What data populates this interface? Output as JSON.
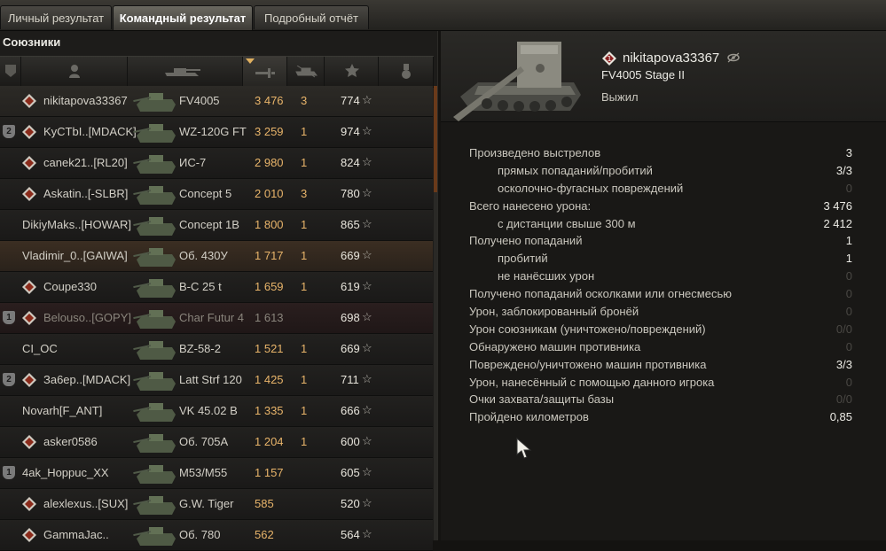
{
  "tabs": [
    {
      "label": "Личный результат"
    },
    {
      "label": "Командный результат"
    },
    {
      "label": "Подробный отчёт"
    }
  ],
  "allies_title": "Союзники",
  "allies": [
    {
      "player": "nikitapova33367",
      "tank": "FV4005",
      "damage": "3 476",
      "kills": "3",
      "xp": "774",
      "platoon": "",
      "rank": "rank-icon"
    },
    {
      "player": "KyCTbI..[MDACK]",
      "tank": "WZ-120G FT",
      "damage": "3 259",
      "kills": "1",
      "xp": "974",
      "platoon": "2",
      "rank": "clan-emblem-icon"
    },
    {
      "player": "canek21..[RL20]",
      "tank": "ИС-7",
      "damage": "2 980",
      "kills": "1",
      "xp": "824",
      "platoon": "",
      "rank": "rank-icon"
    },
    {
      "player": "Askatin..[-SLBR]",
      "tank": "Concept 5",
      "damage": "2 010",
      "kills": "3",
      "xp": "780",
      "platoon": "",
      "rank": "rank-icon"
    },
    {
      "player": "DikiyMaks..[HOWAR]",
      "tank": "Concept 1B",
      "damage": "1 800",
      "kills": "1",
      "xp": "865",
      "platoon": "",
      "rank": ""
    },
    {
      "player": "Vladimir_0..[GAIWA]",
      "tank": "Об. 430У",
      "damage": "1 717",
      "kills": "1",
      "xp": "669",
      "platoon": "",
      "rank": ""
    },
    {
      "player": "Coupe330",
      "tank": "B-C 25 t",
      "damage": "1 659",
      "kills": "1",
      "xp": "619",
      "platoon": "",
      "rank": "rank-icon"
    },
    {
      "player": "Belouso..[GOPY]",
      "tank": "Char Futur 4",
      "damage": "1 613",
      "kills": "",
      "xp": "698",
      "platoon": "1",
      "rank": "rank-icon"
    },
    {
      "player": "CI_OC",
      "tank": "BZ-58-2",
      "damage": "1 521",
      "kills": "1",
      "xp": "669",
      "platoon": "",
      "rank": ""
    },
    {
      "player": "За6ер..[MDACK]",
      "tank": "Latt Strf 120",
      "damage": "1 425",
      "kills": "1",
      "xp": "711",
      "platoon": "2",
      "rank": "rank-icon"
    },
    {
      "player": "Novarh[F_ANT]",
      "tank": "VK 45.02 B",
      "damage": "1 335",
      "kills": "1",
      "xp": "666",
      "platoon": "",
      "rank": ""
    },
    {
      "player": "asker0586",
      "tank": "Об. 705А",
      "damage": "1 204",
      "kills": "1",
      "xp": "600",
      "platoon": "",
      "rank": "rank-icon"
    },
    {
      "player": "4ak_Hoppuc_XX",
      "tank": "M53/M55",
      "damage": "1 157",
      "kills": "",
      "xp": "605",
      "platoon": "1",
      "rank": ""
    },
    {
      "player": "alexlexus..[SUX]",
      "tank": "G.W. Tiger",
      "damage": "585",
      "kills": "",
      "xp": "520",
      "platoon": "",
      "rank": "rank-icon"
    },
    {
      "player": "GammaJac..",
      "tank": "Об. 780",
      "damage": "562",
      "kills": "",
      "xp": "564",
      "platoon": "",
      "rank": "rank-icon"
    }
  ],
  "detail": {
    "player": "nikitapova33367",
    "vehicle": "FV4005 Stage II",
    "status": "Выжил",
    "stats": [
      {
        "label": "Произведено выстрелов",
        "value": "3",
        "sub": false
      },
      {
        "label": "прямых попаданий/пробитий",
        "value": "3/3",
        "sub": true
      },
      {
        "label": "осколочно-фугасных повреждений",
        "value": "0",
        "sub": true
      },
      {
        "label": "Всего нанесено урона:",
        "value": "3 476",
        "sub": false
      },
      {
        "label": "с дистанции свыше 300 м",
        "value": "2 412",
        "sub": true
      },
      {
        "label": "Получено попаданий",
        "value": "1",
        "sub": false
      },
      {
        "label": "пробитий",
        "value": "1",
        "sub": true
      },
      {
        "label": "не нанёсших урон",
        "value": "0",
        "sub": true
      },
      {
        "label": "Получено попаданий осколками или огнесмесью",
        "value": "0",
        "sub": false
      },
      {
        "label": "Урон, заблокированный бронёй",
        "value": "0",
        "sub": false
      },
      {
        "label": "Урон союзникам (уничтожено/повреждений)",
        "value": "0/0",
        "sub": false
      },
      {
        "label": "Обнаружено машин противника",
        "value": "0",
        "sub": false
      },
      {
        "label": "Повреждено/уничтожено машин противника",
        "value": "3/3",
        "sub": false
      },
      {
        "label": "Урон, нанесённый с помощью данного игрока",
        "value": "0",
        "sub": false
      },
      {
        "label": "Очки захвата/защиты базы",
        "value": "0/0",
        "sub": false
      },
      {
        "label": "Пройдено километров",
        "value": "0,85",
        "sub": false
      }
    ]
  }
}
